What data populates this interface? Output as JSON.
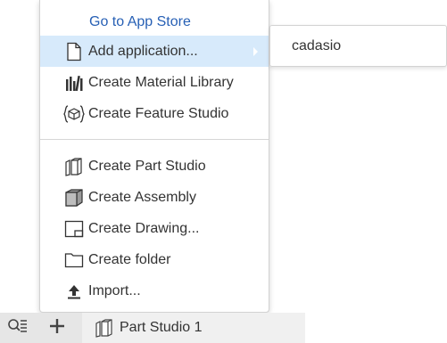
{
  "menu": {
    "goto_app_store": "Go to App Store",
    "items": [
      {
        "label": "Add application...",
        "icon": "document-icon"
      },
      {
        "label": "Create Material Library",
        "icon": "material-library-icon"
      },
      {
        "label": "Create Feature Studio",
        "icon": "feature-studio-icon"
      },
      {
        "label": "Create Part Studio",
        "icon": "part-studio-icon"
      },
      {
        "label": "Create Assembly",
        "icon": "assembly-icon"
      },
      {
        "label": "Create Drawing...",
        "icon": "drawing-icon"
      },
      {
        "label": "Create folder",
        "icon": "folder-icon"
      },
      {
        "label": "Import...",
        "icon": "upload-icon"
      }
    ]
  },
  "submenu": {
    "items": [
      "cadasio"
    ]
  },
  "bottombar": {
    "filter_icon": "filter-list-icon",
    "add_icon": "plus-icon",
    "tab_label": "Part Studio 1",
    "tab_icon": "part-studio-icon"
  },
  "colors": {
    "highlight": "#d7eafb",
    "link": "#2760b5",
    "bottombar": "#e6e6e6"
  }
}
